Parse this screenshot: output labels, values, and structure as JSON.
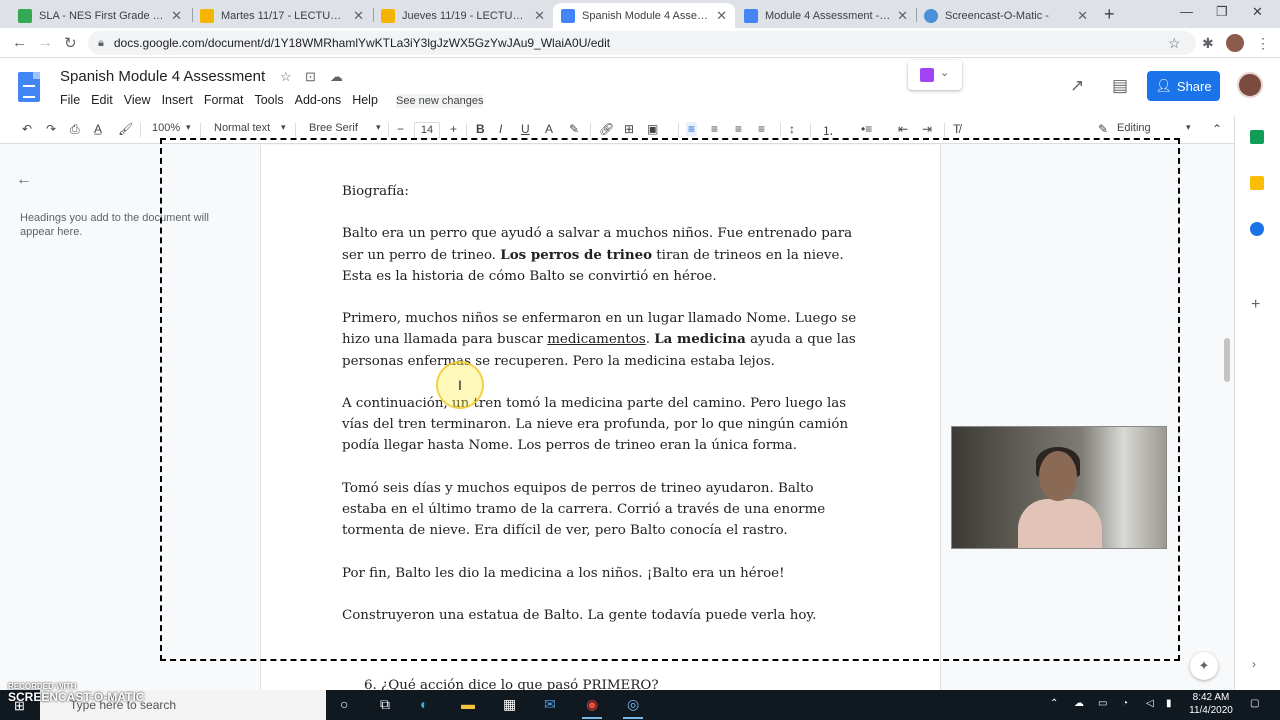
{
  "browser": {
    "tabs": [
      {
        "title": "SLA - NES First Grade Team",
        "favicon_color": "#34a853"
      },
      {
        "title": "Martes 11/17 - LECTURA - Go",
        "favicon_color": "#f4b400"
      },
      {
        "title": "Jueves 11/19 - LECTURA - Go",
        "favicon_color": "#f4b400"
      },
      {
        "title": "Spanish Module 4 Assessme",
        "favicon_color": "#4285f4"
      },
      {
        "title": "Module 4 Assessment - Goo",
        "favicon_color": "#4285f4"
      },
      {
        "title": "Screencast-O-Matic -",
        "favicon_color": "#4a90d9"
      }
    ],
    "url": "docs.google.com/document/d/1Y18WMRhamlYwKTLa3iY3lgJzWX5GzYwJAu9_WlaiA0U/edit"
  },
  "docs": {
    "title": "Spanish Module 4 Assessment",
    "menu": [
      "File",
      "Edit",
      "View",
      "Insert",
      "Format",
      "Tools",
      "Add-ons",
      "Help"
    ],
    "see_changes": "See new changes",
    "share_label": "Share",
    "toolbar": {
      "zoom": "100%",
      "style": "Normal text",
      "font": "Bree Serif",
      "font_size": "14",
      "mode": "Editing"
    },
    "outline_hint": "Headings you add to the document will appear here."
  },
  "document": {
    "heading": "Biografía:",
    "p1_a": "Balto era un perro que ayudó a salvar a muchos niños. Fue entrenado para ser un perro de trineo. ",
    "p1_b": "Los perros de trineo",
    "p1_c": " tiran de trineos en la nieve. Esta es la historia de cómo Balto se convirtió en héroe.",
    "p2_a": "Primero, muchos niños se enfermaron en un lugar llamado Nome. Luego se hizo una llamada para buscar ",
    "p2_b": "medicamentos",
    "p2_c": ". ",
    "p2_d": "La medicina",
    "p2_e": " ayuda a que las personas enfermas se recuperen. Pero la medicina estaba lejos.",
    "p3": "A continuación, un tren tomó la medicina parte del camino. Pero luego las vías del tren terminaron. La nieve era profunda, por lo que ningún camión podía llegar hasta Nome. Los perros de trineo eran la única forma.",
    "p4": "Tomó seis días y muchos equipos de perros de trineo ayudaron. Balto estaba en el último tramo de la carrera. Corrió a través de una enorme tormenta de nieve. Era difícil de ver, pero Balto conocía el rastro.",
    "p5": "Por fin, Balto les dio la medicina a los niños. ¡Balto era un héroe!",
    "p6": "Construyeron una estatua de Balto. La gente todavía puede verla hoy.",
    "next_partial": "6. ¿Qué acción dice lo que pasó PRIMERO?"
  },
  "taskbar": {
    "search_placeholder": "Type here to search",
    "time": "8:42 AM",
    "date": "11/4/2020"
  },
  "recorder": {
    "line1": "RECORDED WITH",
    "line2": "SCREENCAST-O-MATIC"
  }
}
